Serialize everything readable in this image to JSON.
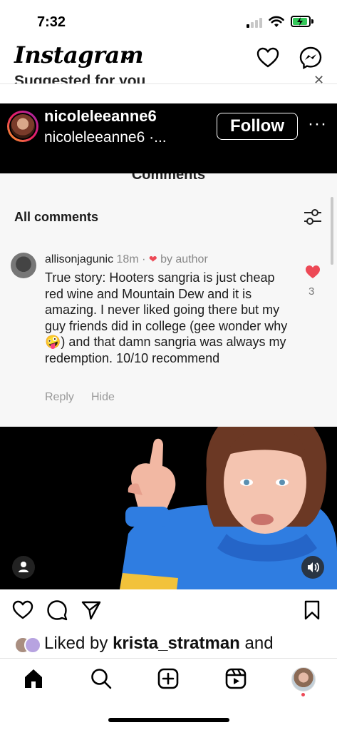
{
  "status_bar": {
    "time": "7:32"
  },
  "header": {
    "logo": "Instagram",
    "icons": [
      "chevron-down-icon",
      "heart-icon",
      "messenger-icon"
    ]
  },
  "feed": {
    "suggested_label": "Suggested for you"
  },
  "post": {
    "username": "nicoleleeanne6",
    "subtitle": "nicoleleeanne6 ·...",
    "follow_label": "Follow",
    "more": "···"
  },
  "comments_panel": {
    "title": "Comments",
    "section_label": "All comments",
    "comment": {
      "author": "allisonjagunic",
      "time": "18m",
      "by_author": "by author",
      "text": "True story: Hooters sangria is just cheap red wine and Mountain Dew and it is amazing. I never liked going there but my guy friends did in college (gee wonder why 🤪) and that damn sangria was always my redemption. 10/10 recommend",
      "like_count": "3",
      "reply_label": "Reply",
      "hide_label": "Hide"
    }
  },
  "likes": {
    "liked_by_prefix": "Liked by ",
    "liked_by_user": "krista_stratman",
    "liked_by_suffix": " and"
  },
  "nav": {
    "items": [
      "home-icon",
      "search-icon",
      "create-icon",
      "reels-icon",
      "profile-avatar"
    ]
  },
  "colors": {
    "like_red": "#ed4956",
    "battery_green": "#34c759",
    "follow_border": "#ffffff"
  }
}
